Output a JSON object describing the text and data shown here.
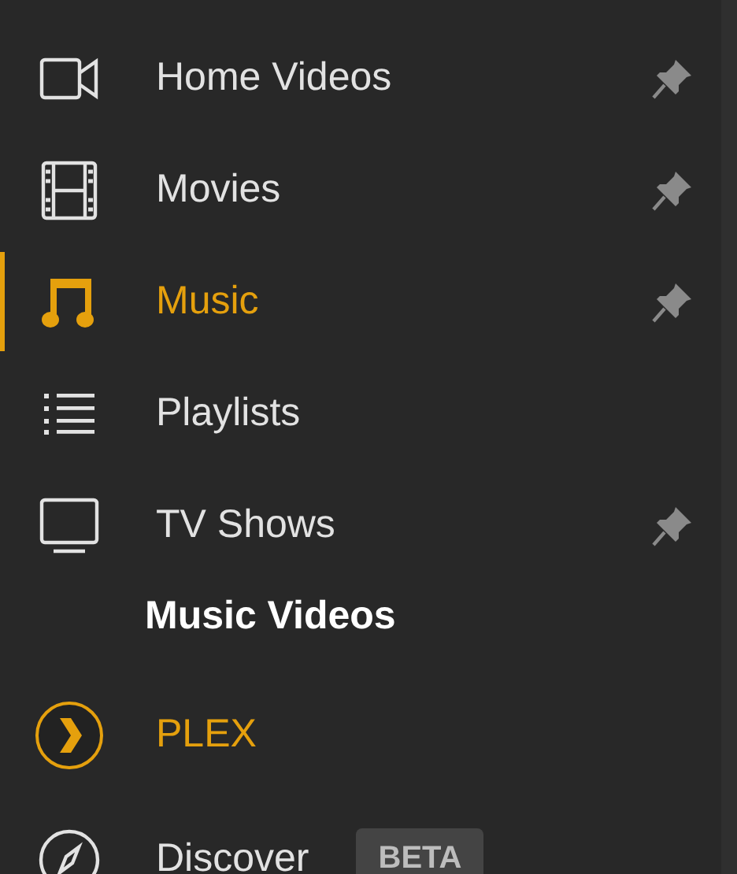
{
  "sidebar": {
    "items": [
      {
        "kind": "video",
        "label": "Home Videos",
        "selected": false,
        "pinned": true
      },
      {
        "kind": "film",
        "label": "Movies",
        "selected": false,
        "pinned": true
      },
      {
        "kind": "music",
        "label": "Music",
        "selected": true,
        "pinned": true
      },
      {
        "kind": "list",
        "label": "Playlists",
        "selected": false,
        "pinned": false
      },
      {
        "kind": "tv",
        "label": "TV Shows",
        "selected": false,
        "pinned": true
      },
      {
        "kind": "heading",
        "label": "Music Videos"
      },
      {
        "kind": "plex",
        "label": "PLEX",
        "selected": false
      },
      {
        "kind": "discover",
        "label": "Discover",
        "selected": false,
        "badge": "BETA"
      }
    ]
  }
}
